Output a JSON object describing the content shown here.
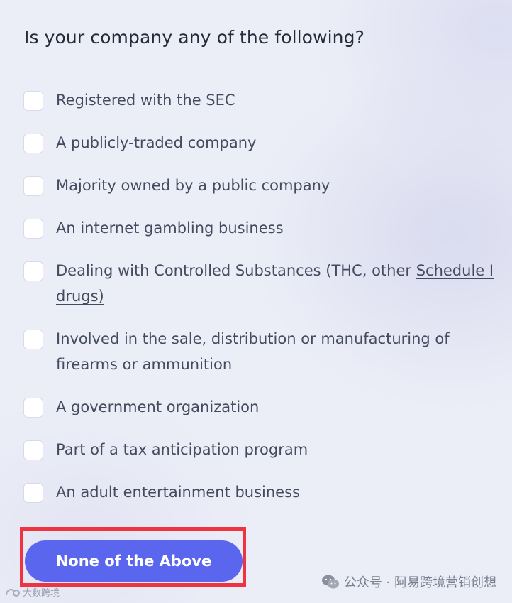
{
  "question": "Is your company any of the following?",
  "options": [
    {
      "label": "Registered with the SEC"
    },
    {
      "label": "A publicly-traded company"
    },
    {
      "label": "Majority owned by a public company"
    },
    {
      "label": "An internet gambling business"
    },
    {
      "label_prefix": "Dealing with Controlled Substances (THC, other ",
      "label_link": "Schedule I drugs)"
    },
    {
      "label": "Involved in the sale, distribution or manufacturing of firearms or ammunition"
    },
    {
      "label": "A government organization"
    },
    {
      "label": "Part of a tax anticipation program"
    },
    {
      "label": "An adult entertainment business"
    }
  ],
  "cta": {
    "label": "None of the Above"
  },
  "highlight_color": "#ef3340",
  "accent_color": "#5b66ee",
  "watermark": {
    "right_text": "公众号 · 阿易跨境营销创想",
    "left_text": "大数跨境",
    "right_icon": "wechat-icon"
  }
}
